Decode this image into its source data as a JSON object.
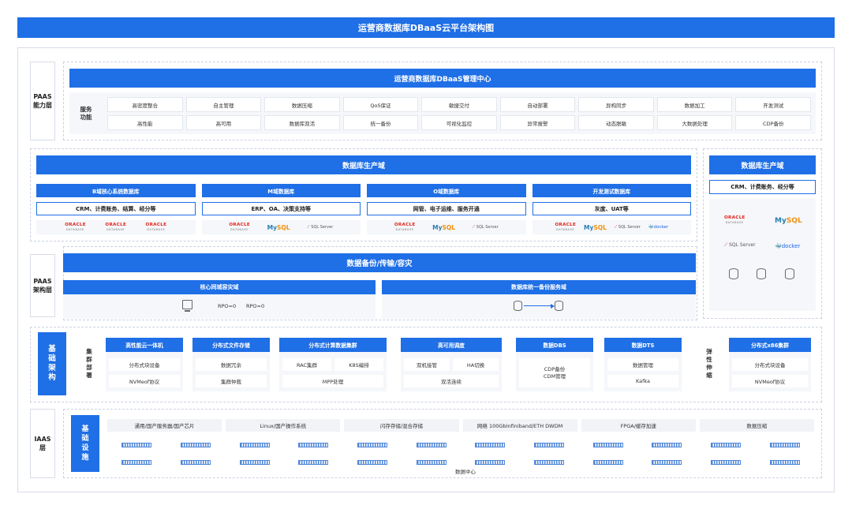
{
  "title": "运营商数据库DBaaS云平台架构图",
  "layers": {
    "paas_cap": "PAAS\n能力层",
    "paas_arch": "PAAS\n架构层",
    "base_arch": "基\n础\n架\n构",
    "iaas": "IAAS\n层"
  },
  "mgmt": {
    "title": "运营商数据库DBaaS管理中心",
    "service_label": "服务\n功能",
    "row1": [
      "高密度整合",
      "自主管理",
      "数据压缩",
      "QoS保证",
      "敏捷交付",
      "自动部署",
      "异构同步",
      "数据加工",
      "开发测试"
    ],
    "row2": [
      "高性能",
      "高可用",
      "数据库双活",
      "统一备份",
      "可视化监控",
      "异常报警",
      "动态脱敏",
      "大数据处理",
      "CDP备份"
    ]
  },
  "prod": {
    "title": "数据库生产域",
    "domains": [
      {
        "title": "B域核心系统数据库",
        "desc": "CRM、计费账务、结算、经分等",
        "logos": [
          "oracle",
          "oracle",
          "oracle"
        ]
      },
      {
        "title": "M域数据库",
        "desc": "ERP、OA、决策支持等",
        "logos": [
          "oracle",
          "mysql",
          "sqlserver"
        ]
      },
      {
        "title": "O域数据库",
        "desc": "网管、电子运维、服务开通",
        "logos": [
          "oracle",
          "mysql",
          "sqlserver"
        ]
      },
      {
        "title": "开发测试数据库",
        "desc": "灰度、UAT等",
        "logos": [
          "oracle",
          "mysql",
          "sqlserver",
          "docker"
        ]
      }
    ],
    "right_title": "数据库生产域",
    "right_desc": "CRM、计费账务、经分等"
  },
  "logo_text": {
    "oracle": "ORACLE",
    "oracle_sub": "DATABASE",
    "mysql_a": "My",
    "mysql_b": "SQL",
    "sqlserver": "SQL Server",
    "docker": "docker"
  },
  "backup": {
    "title": "数据备份/传输/容灾",
    "left_title": "核心同城容灾域",
    "rpo1": "RPO=0",
    "rpo2": "RPO=0",
    "right_title": "数据库统一备份服务域"
  },
  "infra": {
    "cluster_label": "集\n群\n部\n署",
    "elastic_label": "弹\n性\n伸\n缩",
    "groups": [
      {
        "title": "高性能云一体机",
        "items": [
          "分布式块设备",
          "NVMeof协议"
        ]
      },
      {
        "title": "分布式文件存储",
        "items": [
          "数据冗余",
          "集群仲裁"
        ]
      },
      {
        "title": "分布式计算数据集群",
        "items": [
          "RAC集群",
          "K8S编排",
          "MPP处理"
        ]
      },
      {
        "title": "高可用调度",
        "items": [
          "双机接管",
          "HA切换",
          "双活连续"
        ]
      },
      {
        "title": "数据DBS",
        "items": [
          "CDP备份\nCDM管理"
        ]
      },
      {
        "title": "数据DTS",
        "items": [
          "数据管理",
          "Kafka"
        ]
      },
      {
        "title": "分布式x86集群",
        "items": [
          "分布式块设备",
          "NVMeof协议"
        ]
      }
    ]
  },
  "iaas": {
    "label": "基\n础\n设\n施",
    "items": [
      "通用/国产服务器/国产芯片",
      "Linux/国产操作系统",
      "闪存存储/混合存储",
      "网络 100GbInfiniband/ETH DWDM",
      "FPGA/缓存加速",
      "数据压缩"
    ],
    "footer": "数据中心"
  },
  "colors": {
    "accent": "#1f6fe6",
    "panel": "#f5f7fa",
    "cell": "#f1f3f7"
  }
}
